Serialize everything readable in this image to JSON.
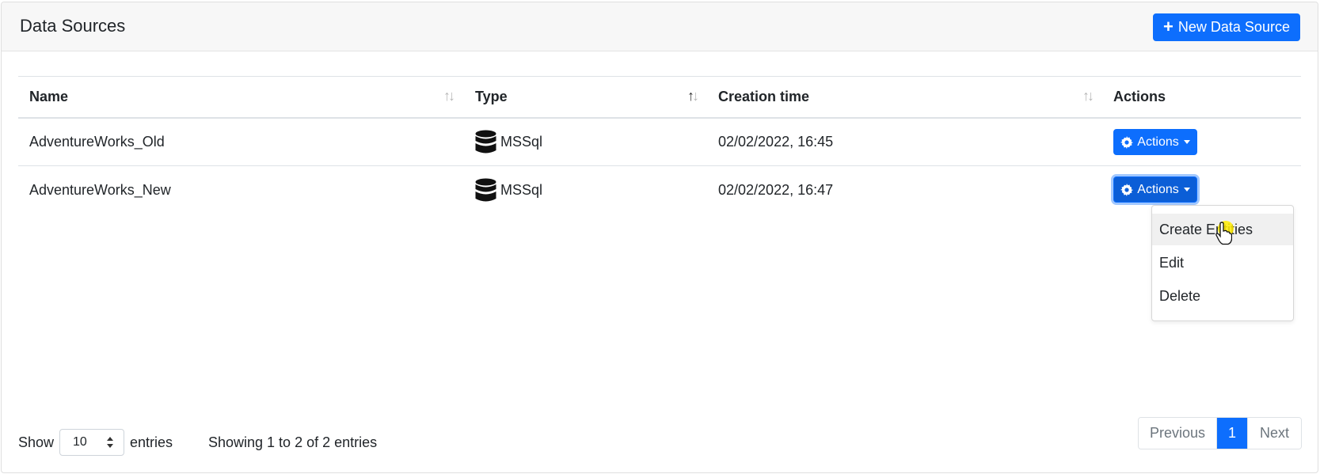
{
  "header": {
    "title": "Data Sources",
    "new_button_label": "New Data Source"
  },
  "table": {
    "columns": [
      "Name",
      "Type",
      "Creation time",
      "Actions"
    ],
    "rows": [
      {
        "name": "AdventureWorks_Old",
        "type": "MSSql",
        "created": "02/02/2022, 16:45",
        "action_label": "Actions"
      },
      {
        "name": "AdventureWorks_New",
        "type": "MSSql",
        "created": "02/02/2022, 16:47",
        "action_label": "Actions"
      }
    ],
    "sort": {
      "column": "Type",
      "direction": "asc"
    }
  },
  "dropdown": {
    "items": [
      "Create Entities",
      "Edit",
      "Delete"
    ],
    "hovered_label": "Create Entities"
  },
  "footer": {
    "show_label": "Show",
    "page_length": "10",
    "entries_label": "entries",
    "info": "Showing 1 to 2 of 2 entries"
  },
  "pagination": {
    "previous": "Previous",
    "current": "1",
    "next": "Next"
  },
  "colors": {
    "primary": "#0d6efd",
    "header_bg": "#f7f7f7"
  }
}
